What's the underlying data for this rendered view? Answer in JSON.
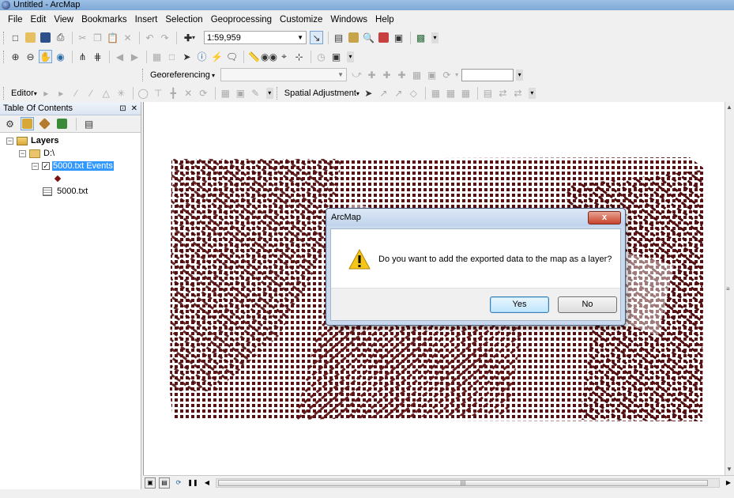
{
  "window": {
    "title": "Untitled - ArcMap"
  },
  "menubar": {
    "items": [
      "File",
      "Edit",
      "View",
      "Bookmarks",
      "Insert",
      "Selection",
      "Geoprocessing",
      "Customize",
      "Windows",
      "Help"
    ]
  },
  "standard_toolbar": {
    "scale": "1:59,959"
  },
  "georef_toolbar": {
    "label": "Georeferencing"
  },
  "editor_toolbar": {
    "editor_label": "Editor",
    "spatial_adjustment_label": "Spatial Adjustment"
  },
  "toc": {
    "title": "Table Of Contents",
    "root": "Layers",
    "folder": "D:\\",
    "layer": "5000.txt Events",
    "layer_checked": true,
    "table": "5000.txt"
  },
  "map": {
    "point_color": "#5a0f10"
  },
  "dialog": {
    "title": "ArcMap",
    "close_glyph": "x",
    "message": "Do you want to add the exported data to the map as a layer?",
    "yes_label": "Yes",
    "no_label": "No"
  },
  "hscroll": {
    "thumb_glyph": "III"
  }
}
